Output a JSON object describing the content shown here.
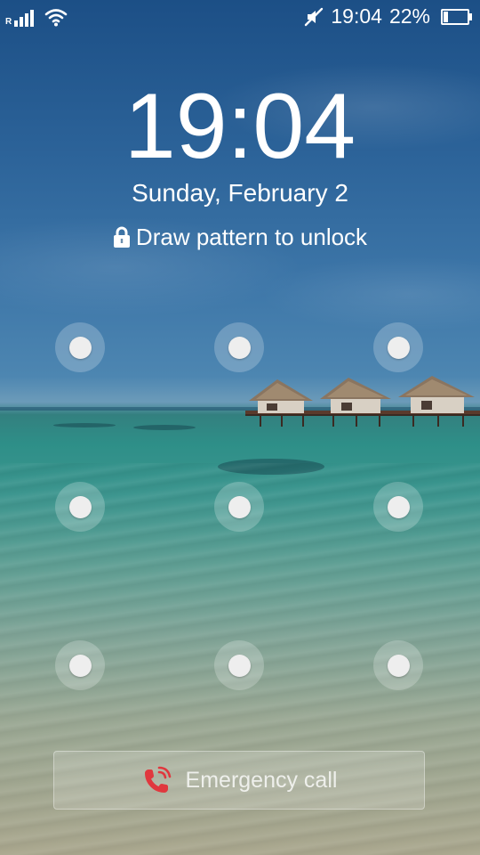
{
  "status_bar": {
    "network_label": "R",
    "time": "19:04",
    "battery_percent": "22%",
    "battery_level": 0.22,
    "icons": [
      "signal-icon",
      "wifi-icon",
      "mute-icon",
      "battery-icon"
    ]
  },
  "lock": {
    "clock": "19:04",
    "date": "Sunday, February 2",
    "hint": "Draw pattern to unlock"
  },
  "pattern": {
    "rows": 3,
    "cols": 3
  },
  "emergency": {
    "label": "Emergency call"
  },
  "colors": {
    "emergency_icon": "#e0383e"
  }
}
